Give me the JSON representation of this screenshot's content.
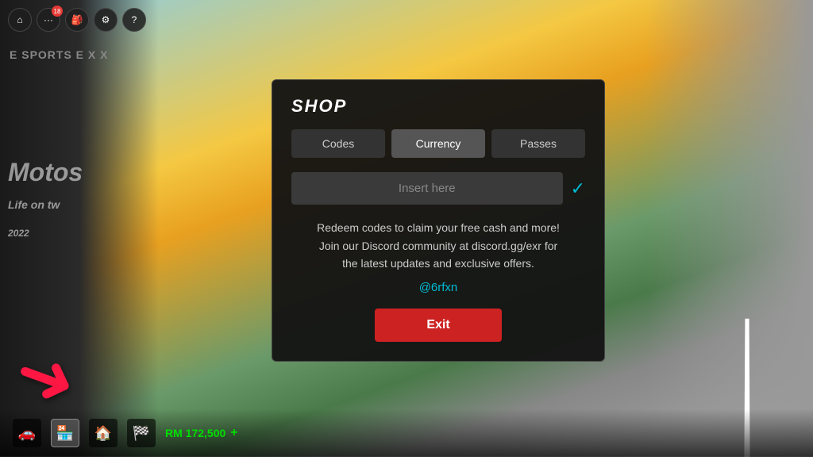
{
  "background": {
    "moto_text": "Motos\nLife on tw\n2022"
  },
  "top_hud": {
    "icons": [
      {
        "name": "home-icon",
        "symbol": "⌂"
      },
      {
        "name": "menu-icon",
        "symbol": "…"
      },
      {
        "name": "inventory-icon",
        "symbol": "🎒"
      },
      {
        "name": "settings-icon",
        "symbol": "⚙"
      },
      {
        "name": "help-icon",
        "symbol": "?"
      }
    ],
    "badge": "18"
  },
  "esports_sign": "E\nSPORTS\nE\nX\nX",
  "shop": {
    "title": "SHOP",
    "tabs": [
      {
        "label": "Codes",
        "active": false
      },
      {
        "label": "Currency",
        "active": true
      },
      {
        "label": "Passes",
        "active": false
      }
    ],
    "input_placeholder": "Insert here",
    "check_symbol": "✓",
    "description": "Redeem codes to claim your free cash and more!\nJoin our Discord community at discord.gg/exr for\nthe latest updates and exclusive offers.",
    "discord_handle": "@6rfxn",
    "exit_label": "Exit"
  },
  "bottom_hud": {
    "icons": [
      {
        "name": "car-icon",
        "symbol": "🚗"
      },
      {
        "name": "shop-icon",
        "symbol": "🏪"
      },
      {
        "name": "garage-icon",
        "symbol": "🏠"
      },
      {
        "name": "race-icon",
        "symbol": "🏁"
      }
    ],
    "currency_label": "RM 172,500",
    "currency_plus": "+"
  },
  "arrow": {
    "symbol": "➜",
    "color": "#ff1744"
  }
}
